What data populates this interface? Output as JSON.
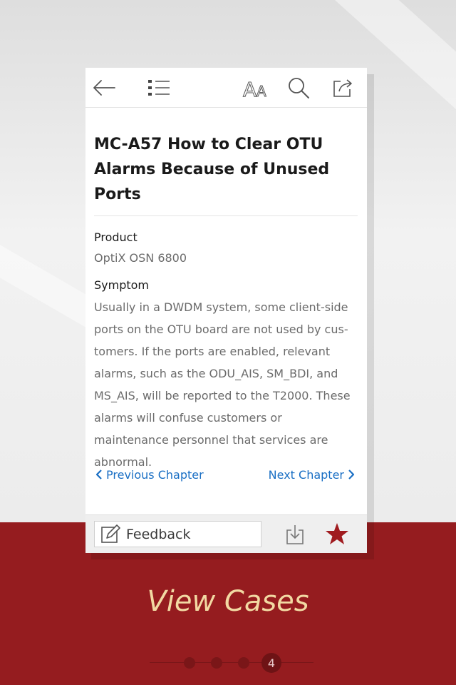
{
  "toolbar": {
    "back_icon": "back-arrow-icon",
    "toc_icon": "list-icon",
    "font_icon": "font-size-icon",
    "font_icon_text": "AA",
    "search_icon": "search-icon",
    "share_icon": "share-icon"
  },
  "article": {
    "title": "MC-A57 How to Clear OTU Alarms Because of Unused Ports",
    "product_heading": "Product",
    "product_value": "OptiX OSN 6800",
    "symptom_heading": "Symptom",
    "symptom_text": "Usually in a DWDM system, some client-side ports on the OTU board are not used by cus-tomers. If the ports are enabled, relevant alarms, such as the ODU_AIS, SM_BDI, and MS_AIS, will be reported to the T2000. These alarms will confuse customers or maintenance personnel that services are abnormal."
  },
  "navigation": {
    "previous_label": "Previous Chapter",
    "next_label": "Next Chapter"
  },
  "bottom_bar": {
    "feedback_label": "Feedback",
    "download_icon": "download-icon",
    "favorite_icon": "star-icon"
  },
  "promo": {
    "caption": "View Cases",
    "page_indicator": "4",
    "page_count": 4
  },
  "colors": {
    "brand_red": "#951c1f",
    "link_blue": "#1a6fc4",
    "star_red": "#a01b1f",
    "caption": "#f2d9a3"
  }
}
